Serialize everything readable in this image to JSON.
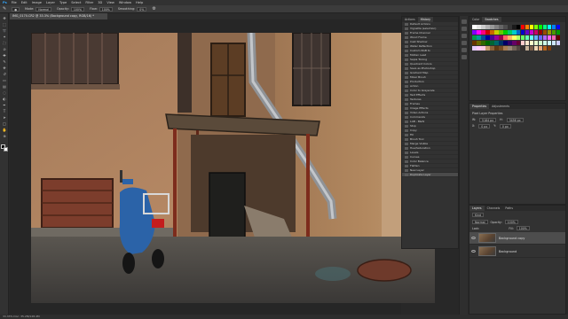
{
  "menu": [
    "Ps",
    "File",
    "Edit",
    "Image",
    "Layer",
    "Type",
    "Select",
    "Filter",
    "3D",
    "View",
    "Window",
    "Help"
  ],
  "options": {
    "mode_label": "Mode:",
    "mode_value": "Normal",
    "opacity_label": "Opacity:",
    "opacity_value": "100%",
    "flow_label": "Flow:",
    "flow_value": "100%",
    "smoothing_label": "Smoothing:",
    "smoothing_value": "0%"
  },
  "document_tab": "IMG_0170.CR2 @ 33.3% (Background copy, RGB/16) *",
  "status": "33.33%   Doc: 35.2M/128.4M",
  "history": {
    "tabs": [
      "Actions",
      "History"
    ],
    "items": [
      "Default Actions",
      "Vignette (selection)",
      "Frame Channel",
      "Wood Frame",
      "Cast Shadow",
      "Water Reflection",
      "Custom RGB to",
      "Molten Lead",
      "Sepia Toning",
      "Quadrant Colors",
      "Save as Photoshop",
      "Gradient Map",
      "Mixer Brush",
      "Production",
      "Action",
      "Color to Grayscale",
      "Text Effects",
      "Textures",
      "Frames",
      "Image Effects",
      "Video Actions",
      "Commands",
      "LAB - B&W",
      "Stop",
      "Copy",
      "Fill",
      "Brush Tool",
      "Merge Visible",
      "Hue/Saturation",
      "Levels",
      "Curves",
      "Color Balance",
      "Flatten",
      "New Layer",
      "Duplicate Layer"
    ],
    "selected_index": 34
  },
  "swatches": {
    "tabs": [
      "Color",
      "Swatches"
    ],
    "colors": [
      "#ffffff",
      "#e6e6e6",
      "#cccccc",
      "#b3b3b3",
      "#999999",
      "#808080",
      "#666666",
      "#4d4d4d",
      "#333333",
      "#1a1a1a",
      "#000000",
      "#ff0000",
      "#ff8000",
      "#ffff00",
      "#80ff00",
      "#00ff00",
      "#00ff80",
      "#00ffff",
      "#0080ff",
      "#0000ff",
      "#8000ff",
      "#ff00ff",
      "#ff0080",
      "#cc0000",
      "#cc6600",
      "#cccc00",
      "#66cc00",
      "#00cc00",
      "#00cc66",
      "#00cccc",
      "#0066cc",
      "#0000cc",
      "#6600cc",
      "#cc00cc",
      "#cc0066",
      "#990000",
      "#994c00",
      "#999900",
      "#4c9900",
      "#009900",
      "#00994c",
      "#009999",
      "#004c99",
      "#000099",
      "#4c0099",
      "#990099",
      "#99004c",
      "#ff6666",
      "#ffb366",
      "#ffff66",
      "#b3ff66",
      "#66ff66",
      "#66ffb3",
      "#66ffff",
      "#66b3ff",
      "#6666ff",
      "#b366ff",
      "#ff66ff",
      "#ff66b3",
      "#660000",
      "#663300",
      "#666600",
      "#336600",
      "#006600",
      "#006633",
      "#006666",
      "#003366",
      "#000066",
      "#330066",
      "#660066",
      "#660033",
      "#ffcccc",
      "#ffe6cc",
      "#ffffcc",
      "#e6ffcc",
      "#ccffcc",
      "#ccffe6",
      "#ccffff",
      "#cce6ff",
      "#ccccff",
      "#e6ccff",
      "#ffccff",
      "#ffcce6",
      "#c69c6d",
      "#8c6239",
      "#603913",
      "#754c24",
      "#a67c52",
      "#998675",
      "#736357",
      "#534741",
      "#362f2d",
      "#c7b299",
      "#7b5e4a",
      "#f2d6b3",
      "#e8a87c",
      "#b5651d",
      "#7d3c0c"
    ]
  },
  "properties": {
    "tabs": [
      "Properties",
      "Adjustments"
    ],
    "title": "Pixel Layer Properties",
    "w_label": "W:",
    "w_value": "5184 px",
    "h_label": "H:",
    "h_value": "3456 px",
    "x_label": "X:",
    "x_value": "0 px",
    "y_label": "Y:",
    "y_value": "0 px"
  },
  "layers": {
    "tabs": [
      "Layers",
      "Channels",
      "Paths"
    ],
    "filter_label": "Kind",
    "blend_mode": "Normal",
    "opacity_label": "Opacity:",
    "opacity_value": "100%",
    "fill_label": "Fill:",
    "fill_value": "100%",
    "lock_label": "Lock:",
    "items": [
      "Background copy",
      "Background"
    ],
    "selected_index": 0
  },
  "colors": {
    "panel_bg": "#323232",
    "selection": "#4b4b4b",
    "canvas_bg": "#262626"
  }
}
